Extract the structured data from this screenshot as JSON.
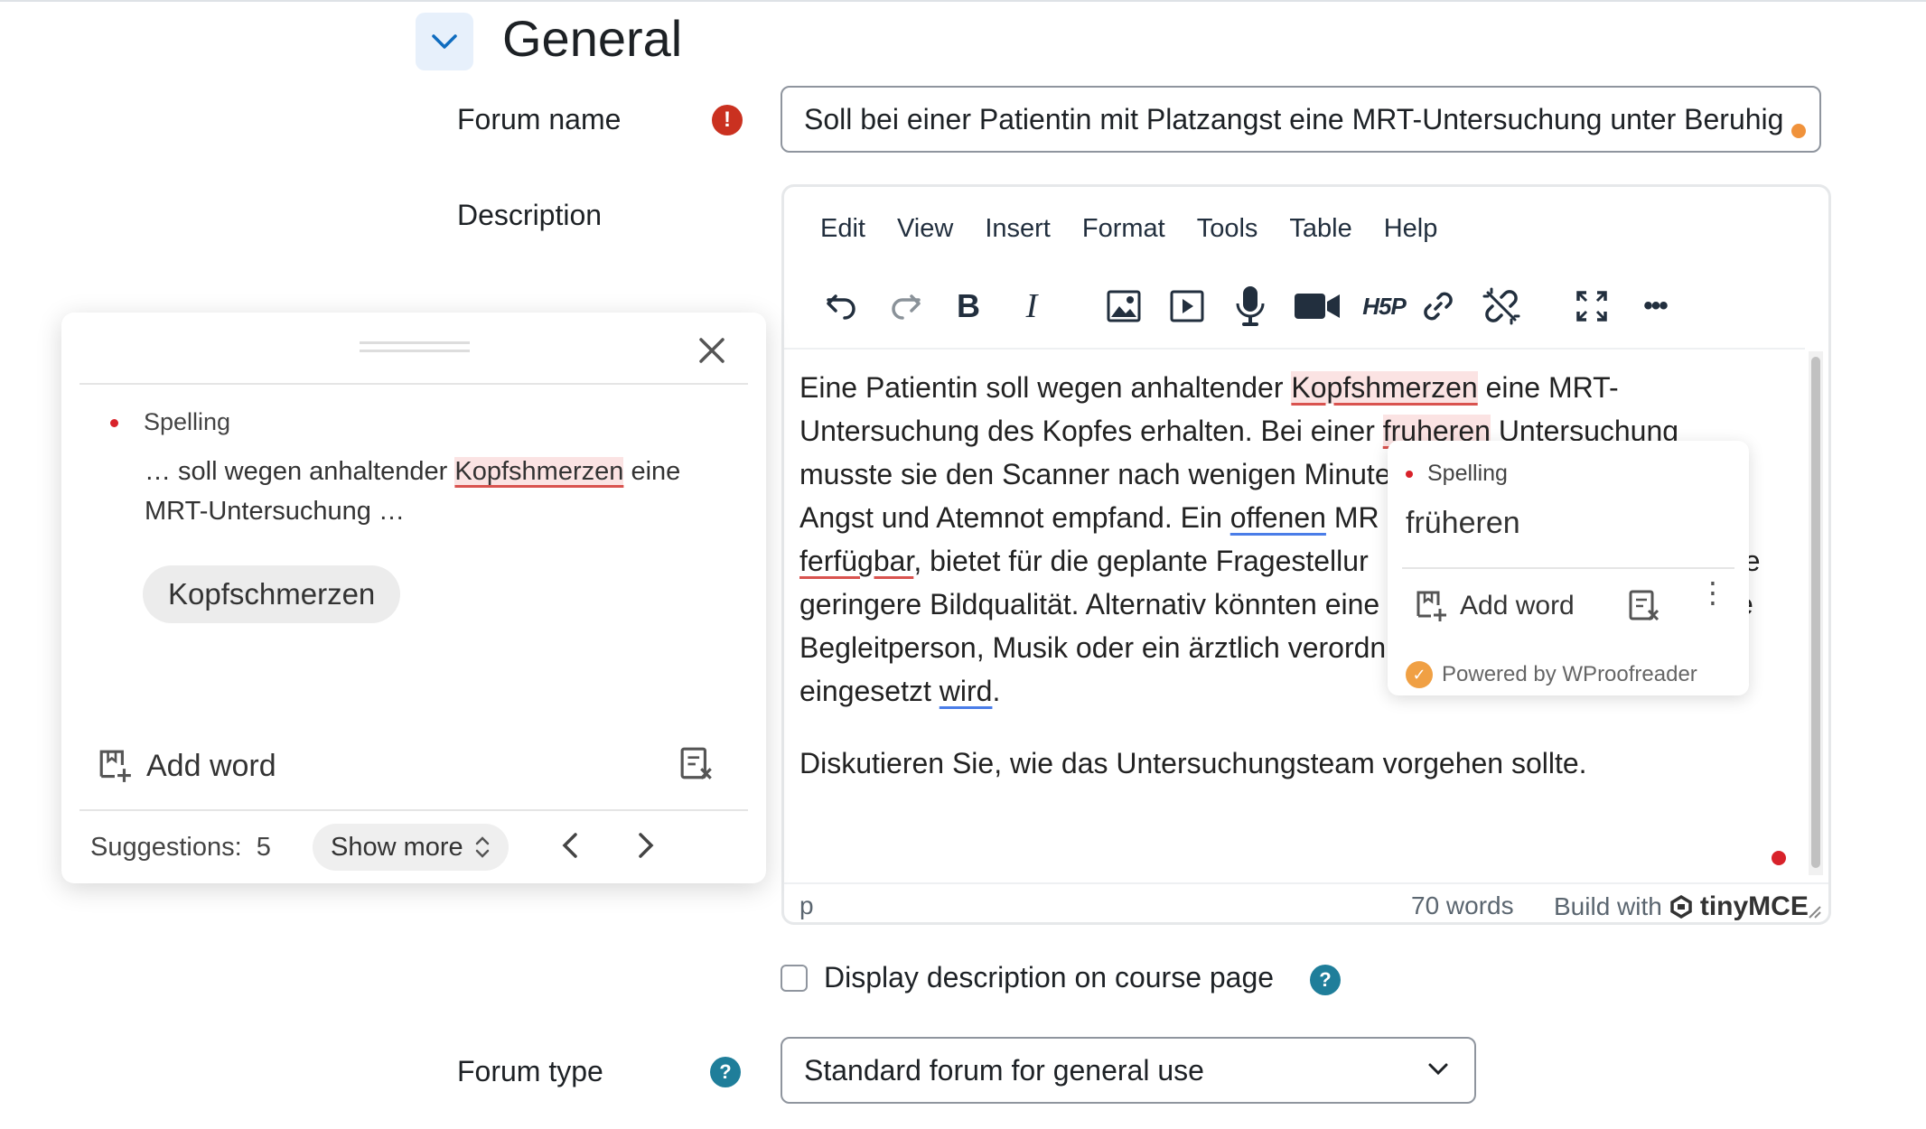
{
  "section": {
    "title": "General"
  },
  "forum_name": {
    "label": "Forum name",
    "required_icon": "!",
    "value": "Soll bei einer Patientin mit Platzangst eine MRT-Untersuchung unter Beruhig"
  },
  "description": {
    "label": "Description"
  },
  "editor": {
    "menu": [
      "Edit",
      "View",
      "Insert",
      "Format",
      "Tools",
      "Table",
      "Help"
    ],
    "toolbar_icons": [
      "undo-icon",
      "redo-icon",
      "bold-icon",
      "italic-icon",
      "image-icon",
      "media-icon",
      "record-audio-icon",
      "record-video-icon",
      "h5p-icon",
      "link-icon",
      "unlink-icon",
      "fullscreen-icon",
      "more-icon"
    ],
    "toolbar_labels": {
      "bold": "B",
      "italic": "I",
      "h5p": "H5P",
      "more": "•••"
    },
    "paragraphs": {
      "p1_line1_a": "Eine Patientin soll wegen anhaltender ",
      "p1_err1": "Kopfshmerzen",
      "p1_line1_b": " eine MRT-",
      "p1_line2_a": "Untersuchung des Kopfes erhalten. Bei einer ",
      "p1_err2": "fruheren",
      "p1_line2_b": " Untersuchung",
      "p1_line3": "musste sie den Scanner nach wenigen Minute",
      "p1_line4_a": "Angst und Atemnot empfand. Ein ",
      "p1_gram1": "offenen",
      "p1_line4_b": " MR",
      "p1_err3": "ferfügbar",
      "p1_line5_b": ", bietet für die geplante Fragestellur",
      "p1_line5_c": "ne",
      "p1_line6_a": "geringere Bildqualität. Alternativ könnten eine",
      "p1_line6_c": "e",
      "p1_line7_a": "Begleitperson, Musik oder ein ärztlich verordn",
      "p1_line8_a": "eingesetzt ",
      "p1_gram2": "wird",
      "p1_line8_b": ".",
      "p2": "Diskutieren Sie, wie das Untersuchungsteam vorgehen sollte."
    },
    "status": {
      "path": "p",
      "words": "70 words",
      "build_with": "Build with",
      "brand": "tinyMCE"
    }
  },
  "inline_popup": {
    "category": "Spelling",
    "suggestion": "früheren",
    "add_word": "Add word",
    "more": "⋮",
    "powered_by": "Powered by WProofreader"
  },
  "panel": {
    "category": "Spelling",
    "context_before": "… soll wegen anhaltender ",
    "context_word": "Kopfshmerzen",
    "context_after": " eine MRT-Untersuchung …",
    "suggestion": "Kopfschmerzen",
    "add_word": "Add word",
    "suggestions_label": "Suggestions:",
    "suggestions_count": "5",
    "show_more": "Show more"
  },
  "display_on_course": {
    "label": "Display description on course page",
    "checked": false
  },
  "forum_type": {
    "label": "Forum type",
    "value": "Standard forum for general use"
  },
  "colors": {
    "required": "#ca3120",
    "help": "#1f7e9a",
    "spelling": "#d9534f",
    "grammar": "#4a7de8",
    "accent_bg": "#e7f0fb"
  }
}
